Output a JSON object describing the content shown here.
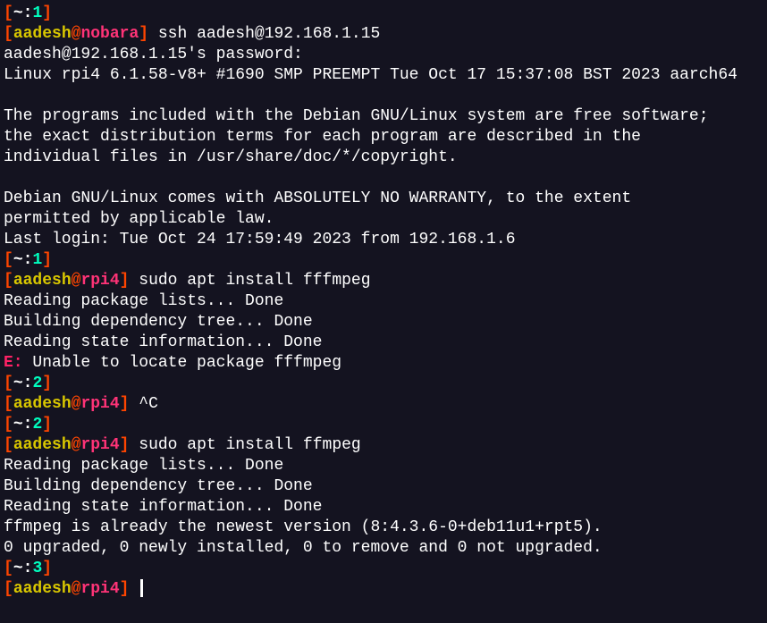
{
  "s1": {
    "num": "1"
  },
  "p1": {
    "user": "aadesh",
    "host": "nobara",
    "cmd": "ssh aadesh@192.168.1.15"
  },
  "pwdline": "aadesh@192.168.1.15's password:",
  "motd1": "Linux rpi4 6.1.58-v8+ #1690 SMP PREEMPT Tue Oct 17 15:37:08 BST 2023 aarch64",
  "motd2": "The programs included with the Debian GNU/Linux system are free software;",
  "motd3": "the exact distribution terms for each program are described in the",
  "motd4": "individual files in /usr/share/doc/*/copyright.",
  "motd5": "Debian GNU/Linux comes with ABSOLUTELY NO WARRANTY, to the extent",
  "motd6": "permitted by applicable law.",
  "lastlogin": "Last login: Tue Oct 24 17:59:49 2023 from 192.168.1.6",
  "s2": {
    "num": "1"
  },
  "p2": {
    "user": "aadesh",
    "host": "rpi4",
    "cmd": "sudo apt install fffmpeg"
  },
  "apt1": "Reading package lists... Done",
  "apt2": "Building dependency tree... Done",
  "apt3": "Reading state information... Done",
  "err_prefix": "E:",
  "err_msg": " Unable to locate package fffmpeg",
  "s3": {
    "num": "2"
  },
  "p3": {
    "user": "aadesh",
    "host": "rpi4",
    "cmd": "^C"
  },
  "s4": {
    "num": "2"
  },
  "p4": {
    "user": "aadesh",
    "host": "rpi4",
    "cmd": "sudo apt install ffmpeg"
  },
  "apt4": "Reading package lists... Done",
  "apt5": "Building dependency tree... Done",
  "apt6": "Reading state information... Done",
  "apt7": "ffmpeg is already the newest version (8:4.3.6-0+deb11u1+rpt5).",
  "apt8": "0 upgraded, 0 newly installed, 0 to remove and 0 not upgraded.",
  "s5": {
    "num": "3"
  },
  "p5": {
    "user": "aadesh",
    "host": "rpi4"
  }
}
